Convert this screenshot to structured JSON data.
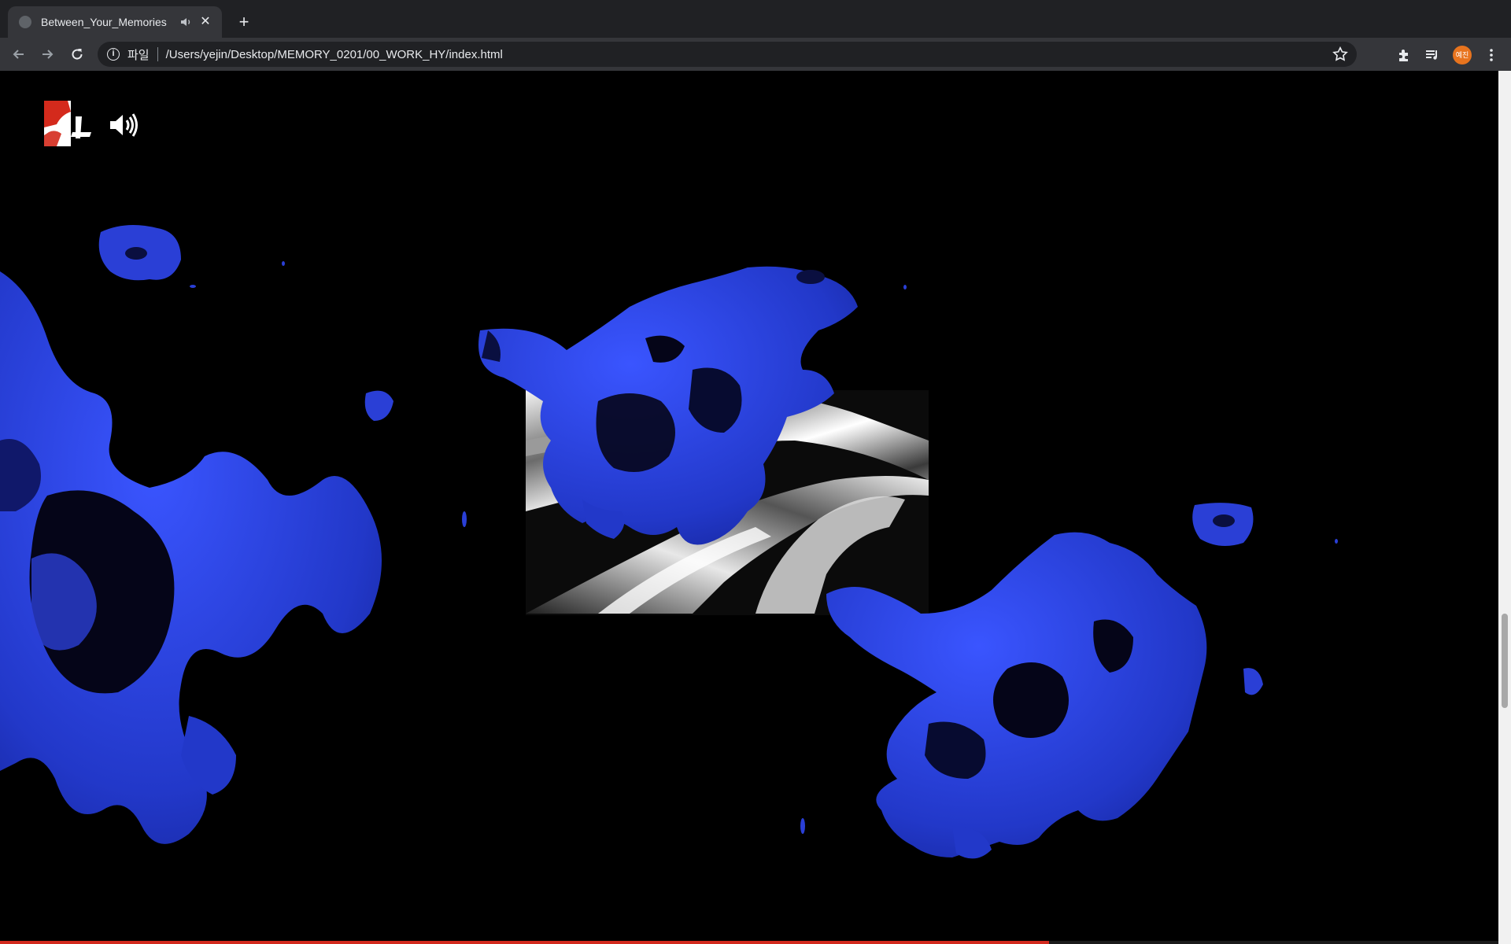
{
  "browser": {
    "tab": {
      "title": "Between_Your_Memories",
      "audio_icon": "speaker-icon",
      "close_label": "✕"
    },
    "new_tab_label": "+",
    "address": {
      "scheme_label": "파일",
      "url": "/Users/yejin/Desktop/MEMORY_0201/00_WORK_HY/index.html"
    },
    "profile": {
      "initials": "예진",
      "color": "#e8741e"
    }
  },
  "page": {
    "logo_icon": "logo-icon",
    "sound_icon": "speaker-wave-icon",
    "accent_blue": "#2a3fd6",
    "progress_color": "#d22a1e",
    "progress_fraction": 0.7
  }
}
